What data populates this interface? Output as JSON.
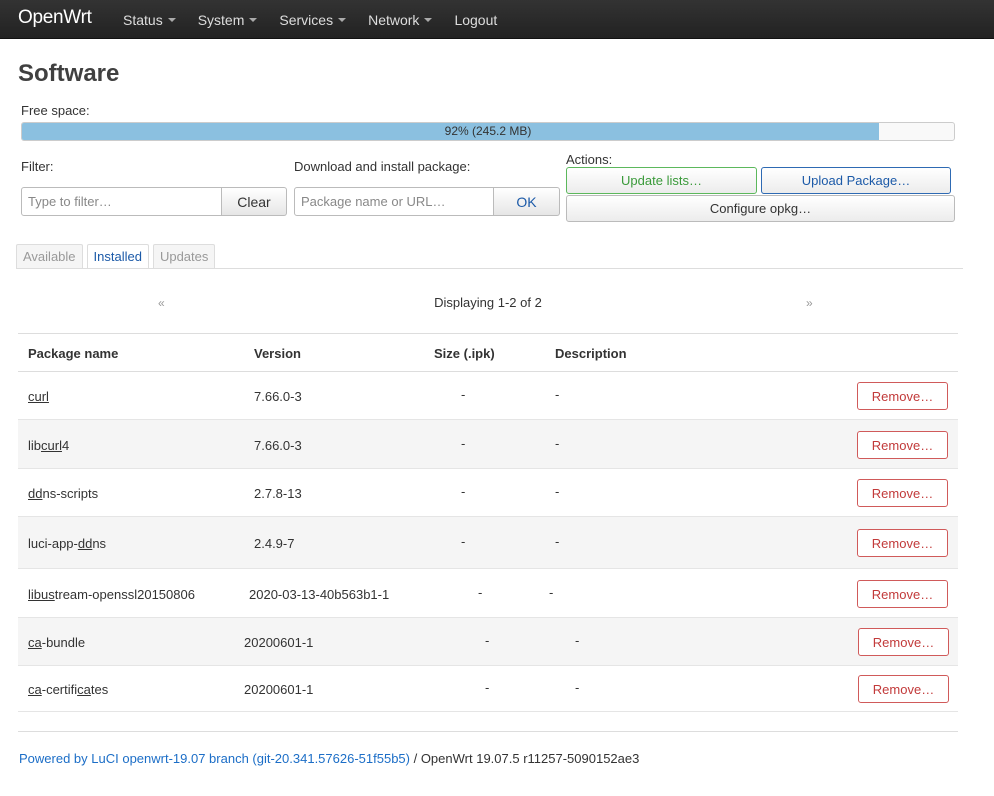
{
  "header": {
    "brand": "OpenWrt",
    "menu": [
      {
        "label": "Status",
        "dropdown": true
      },
      {
        "label": "System",
        "dropdown": true
      },
      {
        "label": "Services",
        "dropdown": true
      },
      {
        "label": "Network",
        "dropdown": true
      },
      {
        "label": "Logout",
        "dropdown": false
      }
    ]
  },
  "page": {
    "title": "Software",
    "free_space_label": "Free space:",
    "free_space_text": "92% (245.2 MB)",
    "free_space_fraction": 0.92,
    "filter_label": "Filter:",
    "filter_placeholder": "Type to filter…",
    "clear_label": "Clear",
    "download_label": "Download and install package:",
    "download_placeholder": "Package name or URL…",
    "ok_label": "OK",
    "actions_label": "Actions:",
    "update_lists_label": "Update lists…",
    "upload_package_label": "Upload Package…",
    "configure_opkg_label": "Configure opkg…"
  },
  "tabs": [
    {
      "label": "Available",
      "active": false
    },
    {
      "label": "Installed",
      "active": true
    },
    {
      "label": "Updates",
      "active": false
    }
  ],
  "pager": {
    "prev": "«",
    "text": "Displaying 1-2 of 2",
    "next": "»"
  },
  "table": {
    "headers": {
      "name": "Package name",
      "version": "Version",
      "size": "Size (.ipk)",
      "description": "Description"
    },
    "rows": [
      {
        "name_parts": [
          {
            "t": "curl",
            "u": true
          }
        ],
        "version": "7.66.0-3",
        "size": "-",
        "description": "-",
        "action": "Remove…"
      },
      {
        "name_parts": [
          {
            "t": "lib",
            "u": false
          },
          {
            "t": "curl",
            "u": true
          },
          {
            "t": "4",
            "u": false
          }
        ],
        "version": "7.66.0-3",
        "size": "-",
        "description": "-",
        "action": "Remove…"
      },
      {
        "name_parts": [
          {
            "t": "dd",
            "u": true
          },
          {
            "t": "ns-scripts",
            "u": false
          }
        ],
        "version": "2.7.8-13",
        "size": "-",
        "description": "-",
        "action": "Remove…"
      },
      {
        "name_parts": [
          {
            "t": "luci-app-",
            "u": false
          },
          {
            "t": "dd",
            "u": true
          },
          {
            "t": "ns",
            "u": false
          }
        ],
        "version": "2.4.9-7",
        "size": "-",
        "description": "-",
        "action": "Remove…"
      },
      {
        "name_parts": [
          {
            "t": "libus",
            "u": true
          },
          {
            "t": "tream-openssl20150806",
            "u": false
          }
        ],
        "version": "2020-03-13-40b563b1-1",
        "size": "-",
        "description": "-",
        "action": "Remove…"
      },
      {
        "name_parts": [
          {
            "t": "ca",
            "u": true
          },
          {
            "t": "-bundle",
            "u": false
          }
        ],
        "version": "20200601-1",
        "size": "-",
        "description": "-",
        "action": "Remove…"
      },
      {
        "name_parts": [
          {
            "t": "ca",
            "u": true
          },
          {
            "t": "-certifi",
            "u": false
          },
          {
            "t": "ca",
            "u": true
          },
          {
            "t": "tes",
            "u": false
          }
        ],
        "version": "20200601-1",
        "size": "-",
        "description": "-",
        "action": "Remove…"
      }
    ]
  },
  "footer": {
    "link_text": "Powered by LuCI openwrt-19.07 branch (git-20.341.57626-51f55b5)",
    "rest_text": " / OpenWrt 19.07.5 r11257-5090152ae3"
  }
}
